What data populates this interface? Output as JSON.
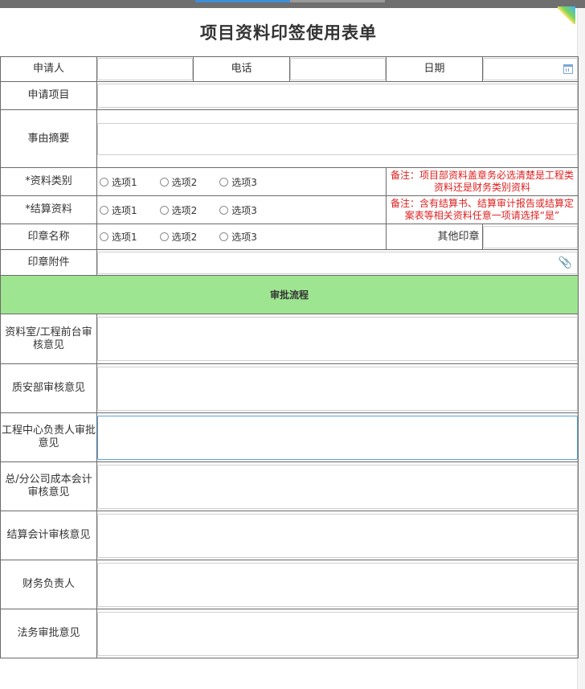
{
  "form": {
    "title": "项目资料印签使用表单",
    "labels": {
      "applicant": "申请人",
      "phone": "电话",
      "date": "日期",
      "project": "申请项目",
      "reason": "事由摘要",
      "material_type": "*资料类别",
      "settlement": "*结算资料",
      "seal_name": "印章名称",
      "other_seal": "其他印章",
      "seal_attachment": "印章附件"
    },
    "radio_options": [
      "选项1",
      "选项2",
      "选项3"
    ],
    "notes": {
      "material_type": "备注：项目部资料盖章务必选清楚是工程类资料还是财务类别资料",
      "settlement": "备注：含有结算书、结算审计报告或结算定案表等相关资料任意一项请选择“是”"
    }
  },
  "approval": {
    "section_title": "审批流程",
    "steps": [
      "资料室/工程前台审核意见",
      "质安部审核意见",
      "工程中心负责人审批意见",
      "总/分公司成本会计审核意见",
      "结算会计审核意见",
      "财务负责人",
      "法务审批意见"
    ]
  },
  "icons": {
    "date_picker": "calendar-icon",
    "attachment": "paperclip-icon"
  },
  "colors": {
    "section_bg": "#9ee591",
    "note_text": "#e02020",
    "focus_border": "#5aa3e0"
  }
}
